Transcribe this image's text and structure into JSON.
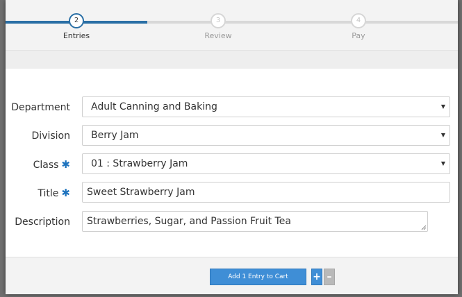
{
  "steps": [
    {
      "number": "2",
      "label": "Entries",
      "state": "active"
    },
    {
      "number": "3",
      "label": "Review",
      "state": "inactive"
    },
    {
      "number": "4",
      "label": "Pay",
      "state": "inactive"
    }
  ],
  "form": {
    "department": {
      "label": "Department",
      "value": "Adult Canning and Baking"
    },
    "division": {
      "label": "Division",
      "value": "Berry Jam"
    },
    "class": {
      "label": "Class",
      "value": "01 : Strawberry Jam"
    },
    "title": {
      "label": "Title",
      "value": "Sweet Strawberry Jam"
    },
    "description": {
      "label": "Description",
      "value": "Strawberries, Sugar, and Passion Fruit Tea"
    },
    "required_marker": "✱",
    "caret": "▼"
  },
  "footer": {
    "add_label": "Add 1 Entry to Cart",
    "plus_label": "+",
    "minus_label": "–"
  },
  "colors": {
    "accent": "#2a6fa5",
    "button": "#3f8ed6",
    "track_done": "#2a6fa5",
    "track_todo": "#d8d8d8"
  }
}
